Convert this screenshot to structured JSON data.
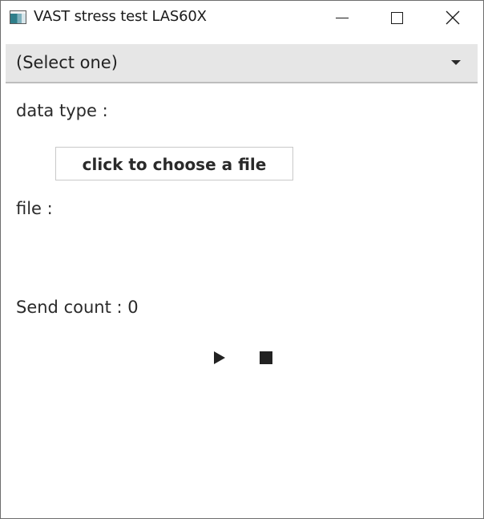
{
  "window": {
    "title": "VAST stress test LAS60X",
    "icons": {
      "app": "app-window-icon",
      "minimize": "minimize-icon",
      "maximize": "maximize-icon",
      "close": "close-icon"
    }
  },
  "select": {
    "value": "(Select one)",
    "icon": "chevron-down-icon"
  },
  "labels": {
    "data_type": "data type :",
    "file": "file :",
    "send_count": "Send count : 0"
  },
  "buttons": {
    "choose_file": "click to choose a file",
    "play_icon": "play-icon",
    "stop_icon": "stop-icon"
  },
  "colors": {
    "select_background": "#e6e6e6",
    "text": "#2a2a2a",
    "background": "#ffffff"
  }
}
